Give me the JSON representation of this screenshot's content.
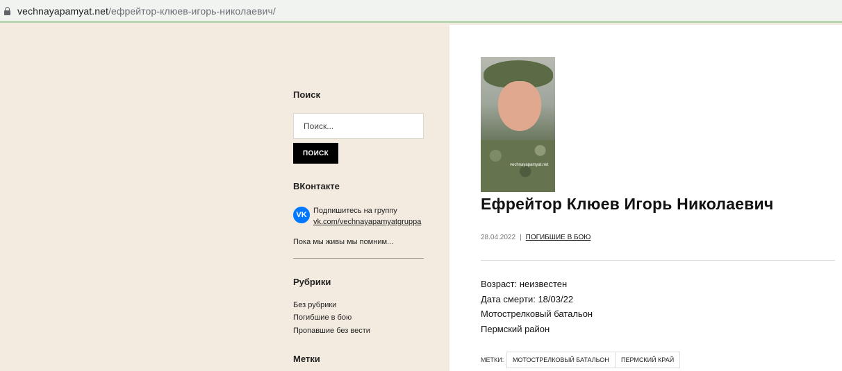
{
  "browser": {
    "url_host": "vechnayapamyat.net",
    "url_path": "/ефрейтор-клюев-игорь-николаевич/"
  },
  "sidebar": {
    "search": {
      "title": "Поиск",
      "placeholder": "Поиск...",
      "button_label": "ПОИСК"
    },
    "vk": {
      "title": "ВКонтакте",
      "icon": "vk-icon",
      "icon_text": "VK",
      "subscribe_text": "Подпишитесь на группу",
      "group_link": "vk.com/vechnayapamyatgruppa",
      "tagline": "Пока мы живы мы помним..."
    },
    "categories": {
      "title": "Рубрики",
      "items": [
        "Без рубрики",
        "Погибшие в бою",
        "Пропавшие без вести"
      ]
    },
    "tags_title": "Метки"
  },
  "post": {
    "photo_watermark": "vechnayapamyat.net",
    "title": "Ефрейтор Клюев Игорь Николаевич",
    "date": "28.04.2022",
    "separator": "|",
    "category": "ПОГИБШИЕ В БОЮ",
    "lines": [
      "Возраст: неизвестен",
      "Дата смерти: 18/03/22",
      "Мотострелковый батальон",
      "Пермский район"
    ],
    "tags_label": "МЕТКИ:",
    "tags": [
      "МОТОСТРЕЛКОВЫЙ БАТАЛЬОН",
      "ПЕРМСКИЙ КРАЙ"
    ]
  },
  "colors": {
    "sidebar_bg": "#f4ebe0",
    "vk_blue": "#0077ff",
    "button_bg": "#000000"
  }
}
